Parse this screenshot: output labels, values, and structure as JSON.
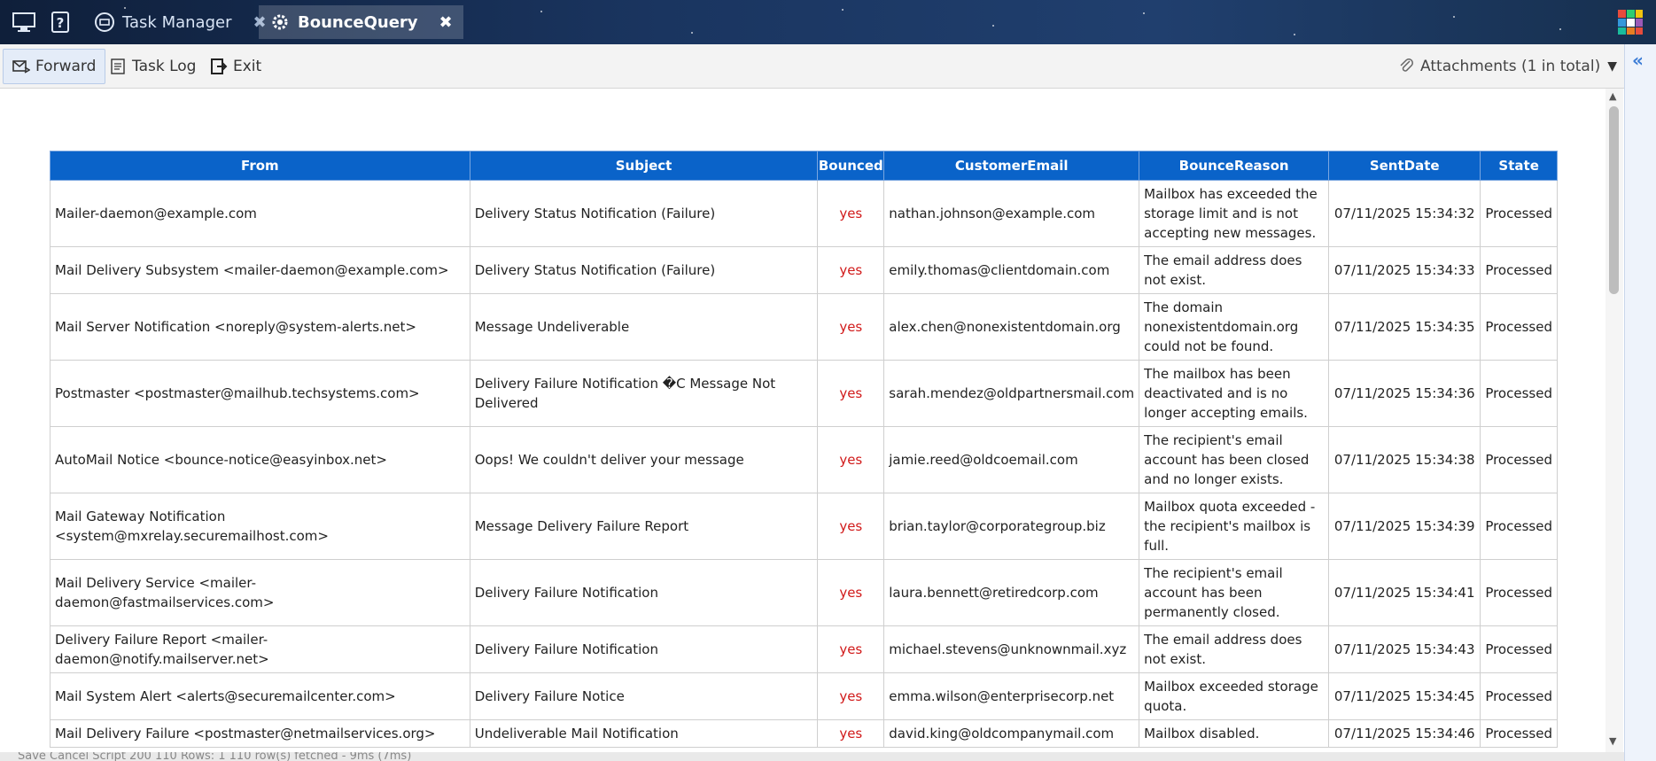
{
  "tabs": [
    {
      "label": "Task Manager",
      "active": false
    },
    {
      "label": "BounceQuery",
      "active": true
    }
  ],
  "toolbar": {
    "forward_label": "Forward",
    "tasklog_label": "Task Log",
    "exit_label": "Exit",
    "attachments_label": "Attachments (1 in total)"
  },
  "table": {
    "headers": [
      "From",
      "Subject",
      "Bounced",
      "CustomerEmail",
      "BounceReason",
      "SentDate",
      "State"
    ],
    "rows": [
      [
        "Mailer-daemon@example.com",
        "Delivery Status Notification (Failure)",
        "yes",
        "nathan.johnson@example.com",
        "Mailbox has exceeded the storage limit and is not accepting new messages.",
        "07/11/2025 15:34:32",
        "Processed"
      ],
      [
        "Mail Delivery Subsystem <mailer-daemon@example.com>",
        "Delivery Status Notification (Failure)",
        "yes",
        "emily.thomas@clientdomain.com",
        "The email address does not exist.",
        "07/11/2025 15:34:33",
        "Processed"
      ],
      [
        "Mail Server Notification <noreply@system-alerts.net>",
        "Message Undeliverable",
        "yes",
        "alex.chen@nonexistentdomain.org",
        "The domain nonexistentdomain.org could not be found.",
        "07/11/2025 15:34:35",
        "Processed"
      ],
      [
        "Postmaster <postmaster@mailhub.techsystems.com>",
        "Delivery Failure Notification �C Message Not Delivered",
        "yes",
        "sarah.mendez@oldpartnersmail.com",
        "The mailbox has been deactivated and is no longer accepting emails.",
        "07/11/2025 15:34:36",
        "Processed"
      ],
      [
        "AutoMail Notice <bounce-notice@easyinbox.net>",
        "Oops! We couldn't deliver your message",
        "yes",
        "jamie.reed@oldcoemail.com",
        "The recipient's email account has been closed and no longer exists.",
        "07/11/2025 15:34:38",
        "Processed"
      ],
      [
        "Mail Gateway Notification <system@mxrelay.securemailhost.com>",
        "Message Delivery Failure Report",
        "yes",
        "brian.taylor@corporategroup.biz",
        "Mailbox quota exceeded - the recipient's mailbox is full.",
        "07/11/2025 15:34:39",
        "Processed"
      ],
      [
        "Mail Delivery Service <mailer-daemon@fastmailservices.com>",
        "Delivery Failure Notification",
        "yes",
        "laura.bennett@retiredcorp.com",
        "The recipient's email account has been permanently closed.",
        "07/11/2025 15:34:41",
        "Processed"
      ],
      [
        "Delivery Failure Report <mailer-daemon@notify.mailserver.net>",
        "Delivery Failure Notification",
        "yes",
        "michael.stevens@unknownmail.xyz",
        "The email address does not exist.",
        "07/11/2025 15:34:43",
        "Processed"
      ],
      [
        "Mail System Alert <alerts@securemailcenter.com>",
        "Delivery Failure Notice",
        "yes",
        "emma.wilson@enterprisecorp.net",
        "Mailbox exceeded storage quota.",
        "07/11/2025 15:34:45",
        "Processed"
      ],
      [
        "Mail Delivery Failure <postmaster@netmailservices.org>",
        "Undeliverable Mail Notification",
        "yes",
        "david.king@oldcompanymail.com",
        "Mailbox disabled.",
        "07/11/2025 15:34:46",
        "Processed"
      ]
    ]
  },
  "statusbar": {
    "text": "Save   Cancel   Script   200   110   Rows: 1   110 row(s) fetched - 9ms (7ms)"
  },
  "colors": {
    "header_bg": "#0a63c9",
    "bounced_text": "#d11a1a",
    "topbar_bg": "#1a3560"
  }
}
